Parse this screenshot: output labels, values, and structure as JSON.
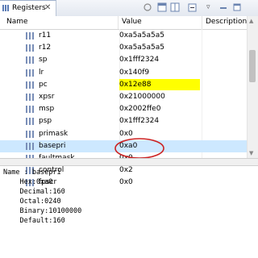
{
  "tab": {
    "title": "Registers"
  },
  "columns": {
    "name": "Name",
    "value": "Value",
    "description": "Description"
  },
  "rows": [
    {
      "name": "r11",
      "value": "0xa5a5a5a5"
    },
    {
      "name": "r12",
      "value": "0xa5a5a5a5"
    },
    {
      "name": "sp",
      "value": "0x1fff2324"
    },
    {
      "name": "lr",
      "value": "0x140f9"
    },
    {
      "name": "pc",
      "value": "0x12e88",
      "highlight": true
    },
    {
      "name": "xpsr",
      "value": "0x21000000"
    },
    {
      "name": "msp",
      "value": "0x2002ffe0"
    },
    {
      "name": "psp",
      "value": "0x1fff2324"
    },
    {
      "name": "primask",
      "value": "0x0"
    },
    {
      "name": "basepri",
      "value": "0xa0",
      "selected": true
    },
    {
      "name": "faultmask",
      "value": "0x0"
    },
    {
      "name": "control",
      "value": "0x2"
    },
    {
      "name": "fpscr",
      "value": "0x0"
    }
  ],
  "details": {
    "name_line": "Name : basepri",
    "hex": "    Hex:0xa0",
    "decimal": "    Decimal:160",
    "octal": "    Octal:0240",
    "binary": "    Binary:10100000",
    "default": "    Default:160"
  },
  "colors": {
    "highlight": "#ffff00",
    "selection": "#cde8ff",
    "annotation": "#cc2222"
  },
  "icons": [
    "registers-icon",
    "close-icon",
    "toolbar-icons",
    "register-icon"
  ]
}
